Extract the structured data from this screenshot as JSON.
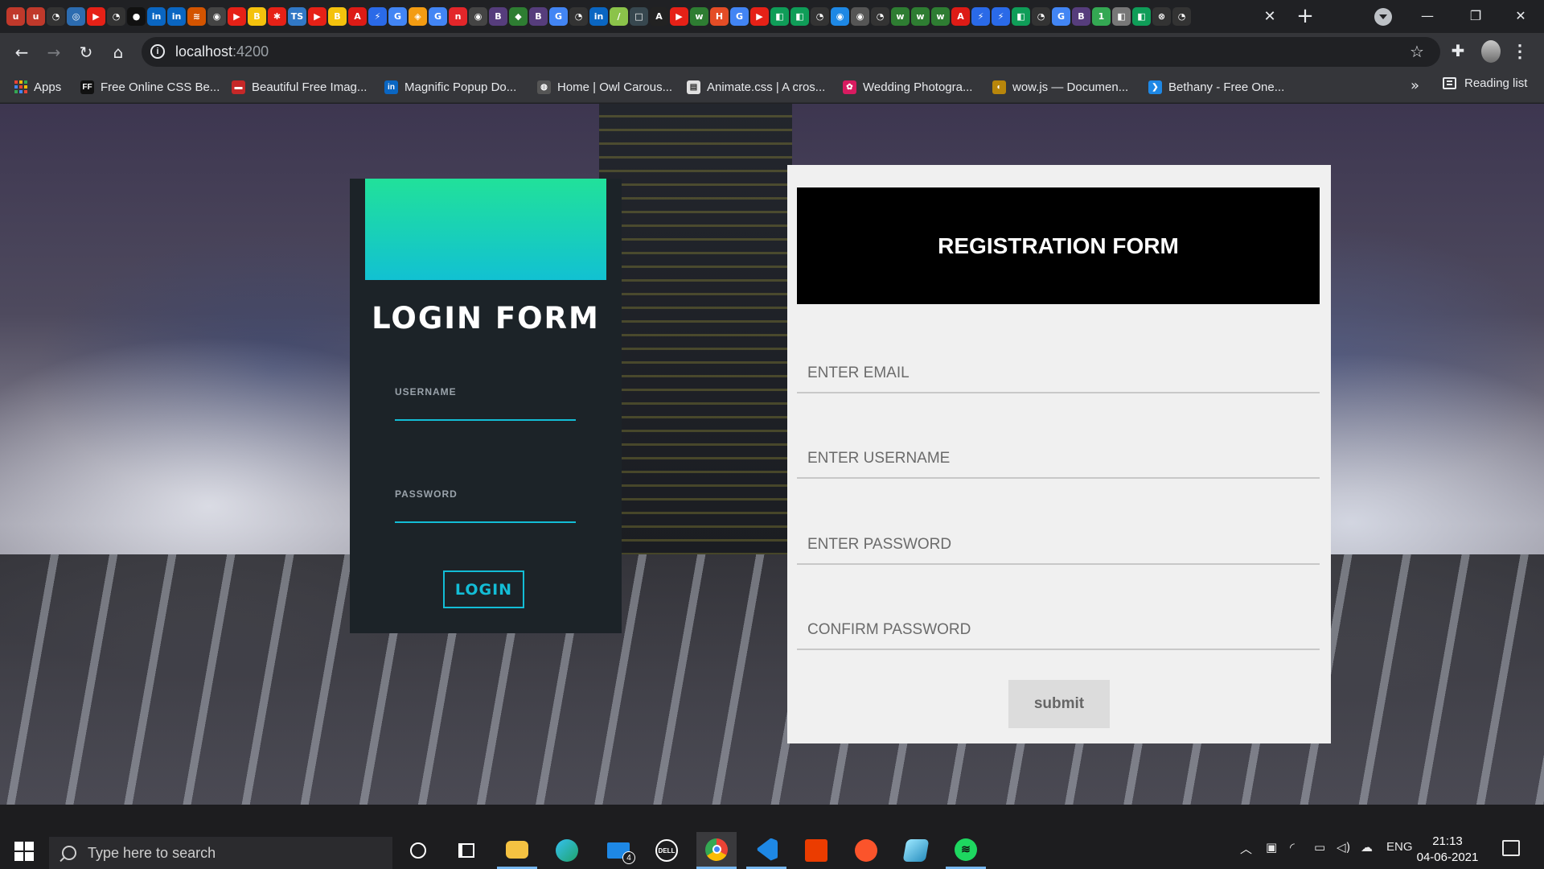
{
  "browser": {
    "url_host": "localhost",
    "url_port": ":4200",
    "tab_favicons": [
      {
        "glyph": "u",
        "color": "#c0392b"
      },
      {
        "glyph": "u",
        "color": "#c0392b"
      },
      {
        "glyph": "◔",
        "color": "#333"
      },
      {
        "glyph": "◎",
        "color": "#2c6cb0"
      },
      {
        "glyph": "▶",
        "color": "#e62117"
      },
      {
        "glyph": "◔",
        "color": "#333"
      },
      {
        "glyph": "●",
        "color": "#111"
      },
      {
        "glyph": "in",
        "color": "#0a66c2"
      },
      {
        "glyph": "in",
        "color": "#0a66c2"
      },
      {
        "glyph": "≋",
        "color": "#d35400"
      },
      {
        "glyph": "◉",
        "color": "#444"
      },
      {
        "glyph": "▶",
        "color": "#e62117"
      },
      {
        "glyph": "B",
        "color": "#f4c20d"
      },
      {
        "glyph": "✱",
        "color": "#e62117"
      },
      {
        "glyph": "TS",
        "color": "#3178c6"
      },
      {
        "glyph": "▶",
        "color": "#e62117"
      },
      {
        "glyph": "B",
        "color": "#f4c20d"
      },
      {
        "glyph": "A",
        "color": "#dd1b16"
      },
      {
        "glyph": "⚡",
        "color": "#2a6ae8"
      },
      {
        "glyph": "G",
        "color": "#4285f4"
      },
      {
        "glyph": "◈",
        "color": "#f39c12"
      },
      {
        "glyph": "G",
        "color": "#4285f4"
      },
      {
        "glyph": "n",
        "color": "#e3262a"
      },
      {
        "glyph": "◉",
        "color": "#444"
      },
      {
        "glyph": "B",
        "color": "#563d7c"
      },
      {
        "glyph": "◆",
        "color": "#2e7d32"
      },
      {
        "glyph": "B",
        "color": "#563d7c"
      },
      {
        "glyph": "G",
        "color": "#4285f4"
      },
      {
        "glyph": "◔",
        "color": "#333"
      },
      {
        "glyph": "in",
        "color": "#0a66c2"
      },
      {
        "glyph": "∕",
        "color": "#8bc34a"
      },
      {
        "glyph": "□",
        "color": "#37474f"
      },
      {
        "glyph": "A",
        "color": "#222"
      },
      {
        "glyph": "▶",
        "color": "#e62117"
      },
      {
        "glyph": "w",
        "color": "#2e7d32"
      },
      {
        "glyph": "H",
        "color": "#e44d26"
      },
      {
        "glyph": "G",
        "color": "#4285f4"
      },
      {
        "glyph": "▶",
        "color": "#e62117"
      },
      {
        "glyph": "◧",
        "color": "#0f9d58"
      },
      {
        "glyph": "◧",
        "color": "#0f9d58"
      },
      {
        "glyph": "◔",
        "color": "#333"
      },
      {
        "glyph": "◉",
        "color": "#1e88e5"
      },
      {
        "glyph": "◉",
        "color": "#555"
      },
      {
        "glyph": "◔",
        "color": "#333"
      },
      {
        "glyph": "w",
        "color": "#2e7d32"
      },
      {
        "glyph": "w",
        "color": "#2e7d32"
      },
      {
        "glyph": "w",
        "color": "#2e7d32"
      },
      {
        "glyph": "A",
        "color": "#dd1b16"
      },
      {
        "glyph": "⚡",
        "color": "#2a6ae8"
      },
      {
        "glyph": "⚡",
        "color": "#2a6ae8"
      },
      {
        "glyph": "◧",
        "color": "#0f9d58"
      },
      {
        "glyph": "◔",
        "color": "#333"
      },
      {
        "glyph": "G",
        "color": "#4285f4"
      },
      {
        "glyph": "B",
        "color": "#563d7c"
      },
      {
        "glyph": "1",
        "color": "#34a853"
      },
      {
        "glyph": "◧",
        "color": "#777"
      },
      {
        "glyph": "◧",
        "color": "#0f9d58"
      },
      {
        "glyph": "⊗",
        "color": "#333"
      },
      {
        "glyph": "◔",
        "color": "#333"
      }
    ]
  },
  "bookmarks": {
    "apps": "Apps",
    "items": [
      {
        "label": "Free Online CSS Be...",
        "icon": "FF",
        "color": "#111"
      },
      {
        "label": "Beautiful Free Imag...",
        "icon": "▬",
        "color": "#c62828"
      },
      {
        "label": "Magnific Popup Do...",
        "icon": "in",
        "color": "#0a66c2"
      },
      {
        "label": "Home | Owl Carous...",
        "icon": "◍",
        "color": "#555"
      },
      {
        "label": "Animate.css | A cros...",
        "icon": "▤",
        "color": "#e0e0e0"
      },
      {
        "label": "Wedding Photogra...",
        "icon": "✿",
        "color": "#d81b60"
      },
      {
        "label": "wow.js — Documen...",
        "icon": "◐",
        "color": "#b8860b"
      },
      {
        "label": "Bethany - Free One...",
        "icon": "❯",
        "color": "#1e88e5"
      }
    ],
    "more": "»",
    "reading_list": "Reading list"
  },
  "login": {
    "title": "LOGIN FORM",
    "username_label": "USERNAME",
    "username_value": "",
    "password_label": "PASSWORD",
    "password_value": "",
    "button": "LOGIN"
  },
  "registration": {
    "title": "REGISTRATION FORM",
    "email_placeholder": "ENTER EMAIL",
    "username_placeholder": "ENTER USERNAME",
    "password_placeholder": "ENTER PASSWORD",
    "confirm_placeholder": "CONFIRM PASSWORD",
    "submit": "submit"
  },
  "taskbar": {
    "search_placeholder": "Type here to search",
    "mail_badge": "4",
    "language": "ENG",
    "time": "21:13",
    "date": "04-06-2021"
  }
}
